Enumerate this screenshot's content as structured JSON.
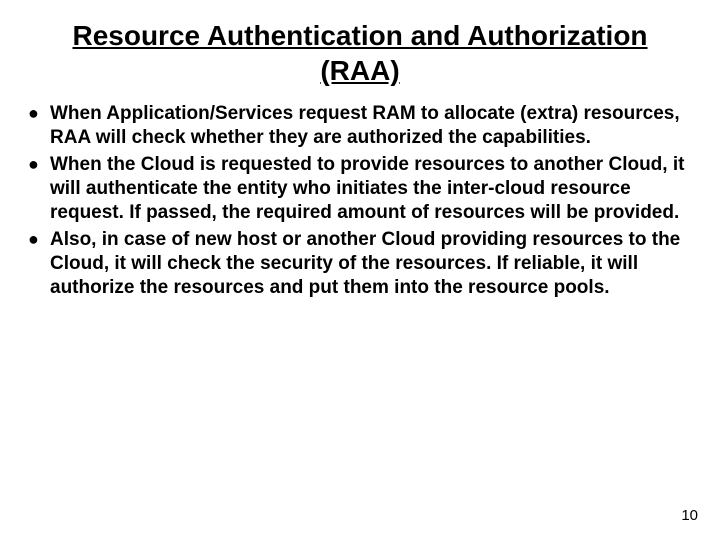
{
  "title": "Resource Authentication and Authorization (RAA)",
  "bullets": [
    "When Application/Services request RAM to allocate (extra) resources, RAA will check whether they are authorized the capabilities.",
    "When the Cloud is requested to provide resources to another Cloud, it will authenticate the entity who initiates the inter-cloud resource request. If passed, the required amount of resources will be provided.",
    "Also, in case of new host or another Cloud providing resources to the Cloud, it will check the security of the resources. If reliable, it will authorize the resources and put them into the resource pools."
  ],
  "page_number": "10"
}
